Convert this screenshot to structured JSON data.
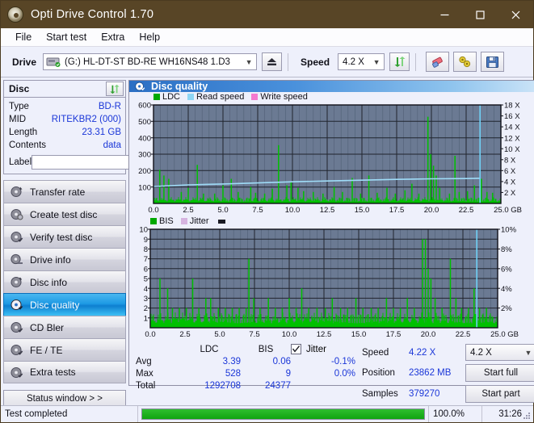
{
  "window": {
    "title": "Opti Drive Control 1.70",
    "icon": "disc-icon"
  },
  "window_controls": {
    "minimize": "minimize-icon",
    "maximize": "maximize-icon",
    "close": "close-icon"
  },
  "menu": {
    "items": [
      "File",
      "Start test",
      "Extra",
      "Help"
    ]
  },
  "toolbar": {
    "drive_label": "Drive",
    "drive_value": "(G:)  HL-DT-ST BD-RE  WH16NS48 1.D3",
    "eject_icon": "eject-icon",
    "speed_label": "Speed",
    "speed_value": "4.2 X",
    "refresh_icon": "refresh-icon",
    "erase_icon": "eraser-icon",
    "tools_icon": "tools-icon",
    "save_icon": "save-icon"
  },
  "disc": {
    "title": "Disc",
    "refresh_icon": "refresh-icon",
    "rows": [
      {
        "key": "Type",
        "value": "BD-R"
      },
      {
        "key": "MID",
        "value": "RITEKBR2 (000)"
      },
      {
        "key": "Length",
        "value": "23.31 GB"
      },
      {
        "key": "Contents",
        "value": "data"
      }
    ],
    "label_key": "Label",
    "label_value": "",
    "label_placeholder": "",
    "label_button_icon": "disc-icon"
  },
  "nav": {
    "items": [
      {
        "label": "Transfer rate",
        "icon": "disc-speed-icon",
        "active": false
      },
      {
        "label": "Create test disc",
        "icon": "disc-write-icon",
        "active": false
      },
      {
        "label": "Verify test disc",
        "icon": "disc-verify-icon",
        "active": false
      },
      {
        "label": "Drive info",
        "icon": "drive-info-icon",
        "active": false
      },
      {
        "label": "Disc info",
        "icon": "disc-info-icon",
        "active": false
      },
      {
        "label": "Disc quality",
        "icon": "disc-quality-icon",
        "active": true
      },
      {
        "label": "CD Bler",
        "icon": "cd-bler-icon",
        "active": false
      },
      {
        "label": "FE / TE",
        "icon": "fe-te-icon",
        "active": false
      },
      {
        "label": "Extra tests",
        "icon": "extra-tests-icon",
        "active": false
      }
    ],
    "status_window_label": "Status window > >"
  },
  "main": {
    "title": "Disc quality",
    "title_icon": "disc-quality-icon"
  },
  "statistics": {
    "col_headers": [
      "LDC",
      "BIS"
    ],
    "jitter_label": "Jitter",
    "jitter_checked": true,
    "rows": [
      {
        "name": "Avg",
        "ldc": "3.39",
        "bis": "0.06",
        "jitter": "-0.1%"
      },
      {
        "name": "Max",
        "ldc": "528",
        "bis": "9",
        "jitter": "0.0%"
      },
      {
        "name": "Total",
        "ldc": "1292708",
        "bis": "24377",
        "jitter": ""
      }
    ]
  },
  "readout": {
    "speed_label": "Speed",
    "speed_value": "4.22 X",
    "speed_select": "4.2 X",
    "position_label": "Position",
    "position_value": "23862 MB",
    "samples_label": "Samples",
    "samples_value": "379270",
    "start_full_label": "Start full",
    "start_part_label": "Start part"
  },
  "statusbar": {
    "message": "Test completed",
    "progress_percent": 100.0,
    "progress_text": "100.0%",
    "elapsed": "31:26"
  },
  "chart_data": [
    {
      "type": "line",
      "name": "ldc-chart",
      "title": "Disc quality",
      "xlabel": "GB",
      "ylabel": "LDC",
      "legend": [
        {
          "label": "LDC",
          "color": "#00a800"
        },
        {
          "label": "Read speed",
          "color": "#8fd6f5"
        },
        {
          "label": "Write speed",
          "color": "#f57ad0"
        }
      ],
      "legend_position": "top-left",
      "grid": true,
      "plot_bg": "#6b7a93",
      "x": [
        0.0,
        2.5,
        5.0,
        7.5,
        10.0,
        12.5,
        15.0,
        17.5,
        20.0,
        22.5,
        25.0
      ],
      "xlim": [
        0,
        25.0
      ],
      "xtick_labels": [
        "0.0",
        "2.5",
        "5.0",
        "7.5",
        "10.0",
        "12.5",
        "15.0",
        "17.5",
        "20.0",
        "22.5",
        "25.0 GB"
      ],
      "ylim": [
        0,
        600
      ],
      "ytick_labels": [
        "600",
        "500",
        "400",
        "300",
        "200",
        "100"
      ],
      "yticks": [
        600,
        500,
        400,
        300,
        200,
        100
      ],
      "y2lim": [
        0,
        18
      ],
      "y2tick_labels": [
        "18 X",
        "16 X",
        "14 X",
        "12 X",
        "10 X",
        "8 X",
        "6 X",
        "4 X",
        "2 X"
      ],
      "y2ticks": [
        18,
        16,
        14,
        12,
        10,
        8,
        6,
        4,
        2
      ],
      "series": [
        {
          "name": "LDC",
          "color": "#00c000",
          "avg": 3.39,
          "max": 528,
          "total": 1292708,
          "spikes": [
            [
              0.45,
              205
            ],
            [
              0.75,
              170
            ],
            [
              1.1,
              150
            ],
            [
              2.0,
              70
            ],
            [
              2.5,
              95
            ],
            [
              3.15,
              235
            ],
            [
              3.6,
              60
            ],
            [
              4.4,
              60
            ],
            [
              5.0,
              110
            ],
            [
              5.6,
              150
            ],
            [
              6.1,
              70
            ],
            [
              7.0,
              100
            ],
            [
              7.35,
              65
            ],
            [
              8.0,
              60
            ],
            [
              8.55,
              90
            ],
            [
              9.0,
              355
            ],
            [
              9.6,
              110
            ],
            [
              9.9,
              130
            ],
            [
              10.4,
              95
            ],
            [
              10.8,
              75
            ],
            [
              11.5,
              70
            ],
            [
              12.2,
              60
            ],
            [
              13.0,
              100
            ],
            [
              13.6,
              70
            ],
            [
              14.3,
              155
            ],
            [
              14.9,
              60
            ],
            [
              15.5,
              170
            ],
            [
              16.1,
              65
            ],
            [
              16.8,
              95
            ],
            [
              17.4,
              60
            ],
            [
              18.1,
              80
            ],
            [
              18.6,
              120
            ],
            [
              19.1,
              60
            ],
            [
              19.75,
              528
            ],
            [
              19.95,
              300
            ],
            [
              20.15,
              230
            ],
            [
              20.35,
              170
            ],
            [
              20.6,
              95
            ],
            [
              21.3,
              60
            ],
            [
              21.7,
              290
            ],
            [
              22.0,
              70
            ],
            [
              22.6,
              75
            ],
            [
              23.1,
              110
            ],
            [
              23.6,
              150
            ],
            [
              24.0,
              70
            ],
            [
              24.4,
              65
            ]
          ],
          "baseline": 25
        },
        {
          "name": "Read speed",
          "color": "#9fdcf7",
          "points": [
            [
              0.0,
              3.1
            ],
            [
              2.5,
              3.4
            ],
            [
              5.0,
              3.55
            ],
            [
              7.5,
              3.75
            ],
            [
              10.0,
              3.95
            ],
            [
              12.5,
              4.1
            ],
            [
              15.0,
              4.25
            ],
            [
              17.5,
              4.4
            ],
            [
              20.0,
              4.5
            ],
            [
              22.5,
              4.55
            ],
            [
              23.5,
              4.6
            ]
          ]
        },
        {
          "name": "Write speed",
          "color": "#f57ad0",
          "points": []
        }
      ]
    },
    {
      "type": "line",
      "name": "bis-chart",
      "xlabel": "GB",
      "ylabel": "BIS",
      "legend": [
        {
          "label": "BIS",
          "color": "#00a800"
        },
        {
          "label": "Jitter",
          "color": "#d6b4e0"
        }
      ],
      "legend_position": "top-left",
      "grid": true,
      "plot_bg": "#6b7a93",
      "xlim": [
        0,
        25.0
      ],
      "xtick_labels": [
        "0.0",
        "2.5",
        "5.0",
        "7.5",
        "10.0",
        "12.5",
        "15.0",
        "17.5",
        "20.0",
        "22.5",
        "25.0 GB"
      ],
      "ylim": [
        0,
        10
      ],
      "ytick_labels": [
        "10",
        "9",
        "8",
        "7",
        "6",
        "5",
        "4",
        "3",
        "2",
        "1"
      ],
      "yticks": [
        10,
        9,
        8,
        7,
        6,
        5,
        4,
        3,
        2,
        1
      ],
      "y2lim": [
        0,
        10
      ],
      "y2tick_labels": [
        "10%",
        "8%",
        "6%",
        "4%",
        "2%"
      ],
      "y2ticks": [
        10,
        8,
        6,
        4,
        2
      ],
      "series": [
        {
          "name": "BIS",
          "color": "#00c000",
          "avg": 0.06,
          "max": 9,
          "total": 24377,
          "spikes": [
            [
              0.7,
              5
            ],
            [
              1.25,
              4
            ],
            [
              1.6,
              2
            ],
            [
              2.1,
              2
            ],
            [
              2.6,
              2
            ],
            [
              3.05,
              5
            ],
            [
              3.5,
              2
            ],
            [
              4.0,
              3
            ],
            [
              4.35,
              3
            ],
            [
              4.9,
              2
            ],
            [
              5.4,
              2
            ],
            [
              5.9,
              2
            ],
            [
              6.4,
              2
            ],
            [
              6.9,
              2
            ],
            [
              7.1,
              7
            ],
            [
              7.45,
              3
            ],
            [
              7.9,
              2
            ],
            [
              8.5,
              3
            ],
            [
              9.0,
              2
            ],
            [
              9.5,
              2
            ],
            [
              10.0,
              3
            ],
            [
              10.5,
              2
            ],
            [
              10.9,
              4
            ],
            [
              11.4,
              2
            ],
            [
              12.0,
              2
            ],
            [
              12.6,
              2
            ],
            [
              13.1,
              3
            ],
            [
              13.7,
              2
            ],
            [
              14.2,
              2
            ],
            [
              14.8,
              3
            ],
            [
              15.3,
              2
            ],
            [
              15.9,
              2
            ],
            [
              16.4,
              2
            ],
            [
              17.0,
              3
            ],
            [
              17.5,
              2
            ],
            [
              18.0,
              2
            ],
            [
              18.5,
              3
            ],
            [
              19.0,
              2
            ],
            [
              19.6,
              9
            ],
            [
              19.8,
              9
            ],
            [
              20.0,
              6
            ],
            [
              20.2,
              5
            ],
            [
              20.5,
              3
            ],
            [
              21.0,
              2
            ],
            [
              21.6,
              7
            ],
            [
              22.0,
              3
            ],
            [
              22.4,
              2
            ],
            [
              22.9,
              2
            ],
            [
              23.3,
              4
            ],
            [
              23.7,
              2
            ],
            [
              24.2,
              2
            ]
          ],
          "baseline": 1
        },
        {
          "name": "Jitter",
          "color": "#d6b4e0",
          "points": []
        }
      ]
    }
  ]
}
